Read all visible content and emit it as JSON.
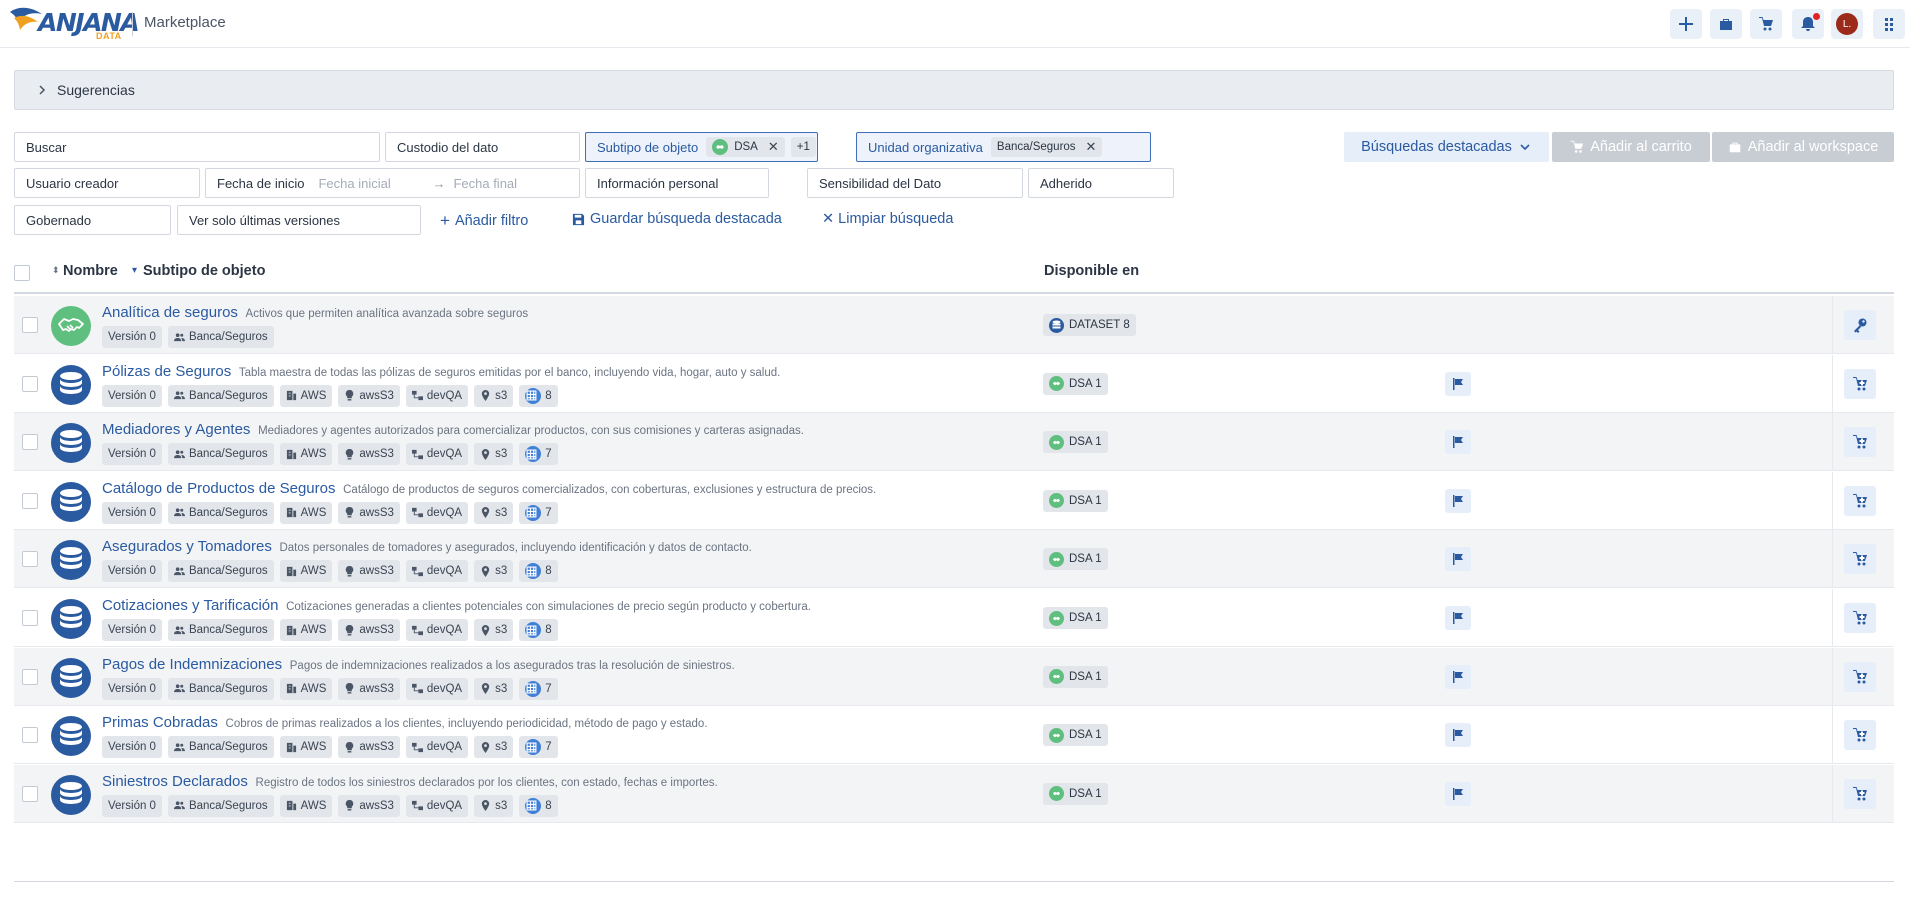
{
  "header": {
    "logo_text": "ANJANA",
    "logo_sub": "DATA",
    "app_title": "Marketplace",
    "avatar_initial": "L."
  },
  "suggestions": {
    "label": "Sugerencias"
  },
  "filters": {
    "search_label": "Buscar",
    "custodian_label": "Custodio del dato",
    "subtype_label": "Subtipo de objeto",
    "subtype_chip": "DSA",
    "subtype_more": "+1",
    "org_unit_label": "Unidad organizativa",
    "org_unit_chip": "Banca/Seguros",
    "creator_label": "Usuario creador",
    "start_date_label": "Fecha de inicio",
    "start_placeholder": "Fecha inicial",
    "end_placeholder": "Fecha final",
    "personal_info_label": "Información personal",
    "sensitivity_label": "Sensibilidad del Dato",
    "adhered_label": "Adherido",
    "governed_label": "Gobernado",
    "latest_versions_label": "Ver solo últimas versiones",
    "add_filter": "Añadir filtro",
    "save_search": "Guardar búsqueda destacada",
    "clear_search": "Limpiar búsqueda",
    "featured_searches": "Búsquedas destacadas",
    "add_to_cart": "Añadir al carrito",
    "add_to_workspace": "Añadir al workspace"
  },
  "table": {
    "col_name": "Nombre",
    "col_subtype": "Subtipo de objeto",
    "col_available": "Disponible en",
    "rows": [
      {
        "name": "Analítica de seguros",
        "desc": "Activos que permiten analítica avanzada sobre seguros",
        "version": "Versión 0",
        "org": "Banca/Seguros",
        "avail": "DATASET 8",
        "kind": "dsa"
      },
      {
        "name": "Pólizas de Seguros",
        "desc": "Tabla maestra de todas las pólizas de seguros emitidas por el banco, incluyendo vida, hogar, auto y salud.",
        "version": "Versión 0",
        "org": "Banca/Seguros",
        "provider": "AWS",
        "location": "awsS3",
        "env": "devQA",
        "tech": "s3",
        "fields": "8",
        "avail": "DSA 1",
        "kind": "dataset"
      },
      {
        "name": "Mediadores y Agentes",
        "desc": "Mediadores y agentes autorizados para comercializar productos, con sus comisiones y carteras asignadas.",
        "version": "Versión 0",
        "org": "Banca/Seguros",
        "provider": "AWS",
        "location": "awsS3",
        "env": "devQA",
        "tech": "s3",
        "fields": "7",
        "avail": "DSA 1",
        "kind": "dataset"
      },
      {
        "name": "Catálogo de Productos de Seguros",
        "desc": "Catálogo de productos de seguros comercializados, con coberturas, exclusiones y estructura de precios.",
        "version": "Versión 0",
        "org": "Banca/Seguros",
        "provider": "AWS",
        "location": "awsS3",
        "env": "devQA",
        "tech": "s3",
        "fields": "7",
        "avail": "DSA 1",
        "kind": "dataset"
      },
      {
        "name": "Asegurados y Tomadores",
        "desc": "Datos personales de tomadores y asegurados, incluyendo identificación y datos de contacto.",
        "version": "Versión 0",
        "org": "Banca/Seguros",
        "provider": "AWS",
        "location": "awsS3",
        "env": "devQA",
        "tech": "s3",
        "fields": "8",
        "avail": "DSA 1",
        "kind": "dataset"
      },
      {
        "name": "Cotizaciones y Tarificación",
        "desc": "Cotizaciones generadas a clientes potenciales con simulaciones de precio según producto y cobertura.",
        "version": "Versión 0",
        "org": "Banca/Seguros",
        "provider": "AWS",
        "location": "awsS3",
        "env": "devQA",
        "tech": "s3",
        "fields": "8",
        "avail": "DSA 1",
        "kind": "dataset"
      },
      {
        "name": "Pagos de Indemnizaciones",
        "desc": "Pagos de indemnizaciones realizados a los asegurados tras la resolución de siniestros.",
        "version": "Versión 0",
        "org": "Banca/Seguros",
        "provider": "AWS",
        "location": "awsS3",
        "env": "devQA",
        "tech": "s3",
        "fields": "7",
        "avail": "DSA 1",
        "kind": "dataset"
      },
      {
        "name": "Primas Cobradas",
        "desc": "Cobros de primas realizados a los clientes, incluyendo periodicidad, método de pago y estado.",
        "version": "Versión 0",
        "org": "Banca/Seguros",
        "provider": "AWS",
        "location": "awsS3",
        "env": "devQA",
        "tech": "s3",
        "fields": "7",
        "avail": "DSA 1",
        "kind": "dataset"
      },
      {
        "name": "Siniestros Declarados",
        "desc": "Registro de todos los siniestros declarados por los clientes, con estado, fechas e importes.",
        "version": "Versión 0",
        "org": "Banca/Seguros",
        "provider": "AWS",
        "location": "awsS3",
        "env": "devQA",
        "tech": "s3",
        "fields": "8",
        "avail": "DSA 1",
        "kind": "dataset"
      }
    ]
  },
  "colors": {
    "accent": "#2a5aa0",
    "green": "#5fbf7f",
    "logo_orange": "#f0a020"
  }
}
